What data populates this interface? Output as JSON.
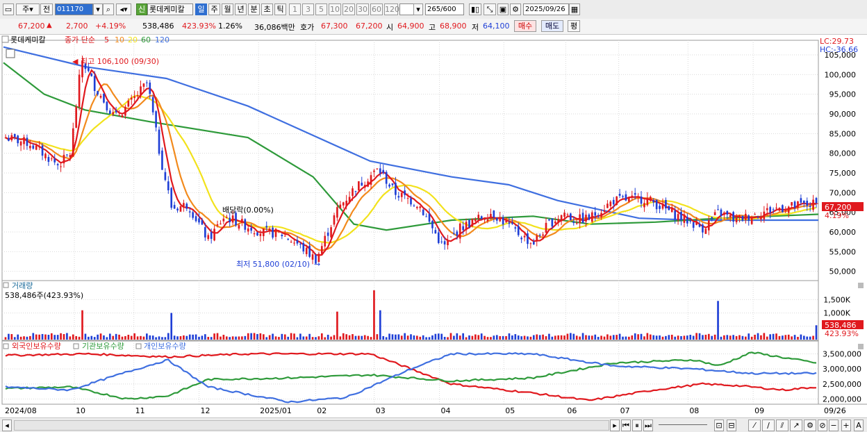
{
  "toolbar": {
    "period_primary": "주",
    "prev_label": "전",
    "stock_code": "011170",
    "badge": "신",
    "stock_name": "롯데케미칼",
    "periods": [
      "일",
      "주",
      "월",
      "년",
      "분",
      "초",
      "틱"
    ],
    "active_period": "일",
    "intervals": [
      "1",
      "3",
      "5",
      "10",
      "20",
      "30",
      "60",
      "120"
    ],
    "count": "265",
    "count_total": "/600",
    "date": "2025/09/26"
  },
  "quote": {
    "price": "67,200",
    "arrow": "▲",
    "change": "2,700",
    "change_pct": "+4.19%",
    "volume": "538,486",
    "volume_pct": "423.93%",
    "turnover_pct": "1.26%",
    "amount": "36,086백만",
    "hoga_label": "호가",
    "ask": "67,300",
    "bid": "67,200",
    "open_label": "시",
    "open": "64,900",
    "high_label": "고",
    "high": "68,900",
    "low_label": "저",
    "low": "64,100",
    "buy_btn": "매수",
    "sell_btn": "매도",
    "eval_btn": "평"
  },
  "legend": {
    "name": "롯데케미칼",
    "ma_label": "종가 단순",
    "periods": [
      "5",
      "10",
      "20",
      "60",
      "120"
    ]
  },
  "annotations": {
    "high": "최고 106,100 (09/30)",
    "low": "최저 51,800 (02/10)",
    "dividend": "배당락(0.00%)",
    "lc": "LC:29.73",
    "hc": "HC:-36.66",
    "last_price": "67,200",
    "last_pct": "4.19%"
  },
  "volume_panel": {
    "title": "거래량",
    "subtitle": "538,486주(423.93%)",
    "last_value": "538,486",
    "last_pct": "423.93%"
  },
  "holdings_panel": {
    "series_labels": [
      "외국인보유수량",
      "기관보유수량",
      "개인보유수량"
    ]
  },
  "colors": {
    "up": "#e0191e",
    "down": "#1f3fd6",
    "ma5": "#e0191e",
    "ma10": "#f28a1c",
    "ma20": "#f2e21c",
    "ma60": "#2e9a3a",
    "ma120": "#3f6fe0",
    "foreign": "#e0191e",
    "institution": "#2e9a3a",
    "individual": "#3f6fe0"
  },
  "chart_data": [
    {
      "type": "candlestick",
      "title": "롯데케미칼",
      "x_ticks": [
        "2024/08",
        "10",
        "11",
        "12",
        "2025/01",
        "02",
        "03",
        "04",
        "05",
        "06",
        "07",
        "08",
        "09",
        "09/26"
      ],
      "ylim": [
        48000,
        108000
      ],
      "y_ticks": [
        50000,
        55000,
        60000,
        65000,
        70000,
        75000,
        80000,
        85000,
        90000,
        95000,
        100000,
        105000
      ],
      "y_tick_labels": [
        "50,000",
        "55,000",
        "60,000",
        "65,000",
        "70,000",
        "75,000",
        "80,000",
        "85,000",
        "90,000",
        "95,000",
        "100,000",
        "105,000"
      ],
      "close_keypoints": [
        {
          "x": "2024/08",
          "y": 84000
        },
        {
          "x": "2024/08 mid",
          "y": 82500
        },
        {
          "x": "2024/09 early",
          "y": 77000
        },
        {
          "x": "2024/09 mid",
          "y": 80000
        },
        {
          "x": "2024/09/30",
          "y": 104000
        },
        {
          "x": "2024/10 early",
          "y": 97000
        },
        {
          "x": "2024/10 mid",
          "y": 89000
        },
        {
          "x": "2024/10 late",
          "y": 93000
        },
        {
          "x": "2024/11 early",
          "y": 98000
        },
        {
          "x": "2024/11 mid",
          "y": 80000
        },
        {
          "x": "2024/11 late",
          "y": 66000
        },
        {
          "x": "2024/12 early",
          "y": 67000
        },
        {
          "x": "2024/12 mid",
          "y": 58000
        },
        {
          "x": "2024/12 late",
          "y": 64000
        },
        {
          "x": "2025/01 early",
          "y": 60000
        },
        {
          "x": "2025/01 mid",
          "y": 59500
        },
        {
          "x": "2025/02 early",
          "y": 57000
        },
        {
          "x": "2025/02/10",
          "y": 53000
        },
        {
          "x": "2025/02 late",
          "y": 66000
        },
        {
          "x": "2025/03 early",
          "y": 71000
        },
        {
          "x": "2025/03 mid",
          "y": 76000
        },
        {
          "x": "2025/03 late",
          "y": 70000
        },
        {
          "x": "2025/04 early",
          "y": 67000
        },
        {
          "x": "2025/04 mid",
          "y": 56000
        },
        {
          "x": "2025/04 late",
          "y": 61000
        },
        {
          "x": "2025/05 early",
          "y": 65000
        },
        {
          "x": "2025/05 mid",
          "y": 60000
        },
        {
          "x": "2025/05 late",
          "y": 57000
        },
        {
          "x": "2025/06 early",
          "y": 62000
        },
        {
          "x": "2025/06 mid",
          "y": 65000
        },
        {
          "x": "2025/06 late",
          "y": 63000
        },
        {
          "x": "2025/07 early",
          "y": 63500
        },
        {
          "x": "2025/07 mid",
          "y": 68000
        },
        {
          "x": "2025/07 late",
          "y": 68500
        },
        {
          "x": "2025/08 early",
          "y": 64000
        },
        {
          "x": "2025/08 mid",
          "y": 61000
        },
        {
          "x": "2025/08 late",
          "y": 65000
        },
        {
          "x": "2025/09 early",
          "y": 63000
        },
        {
          "x": "2025/09 mid",
          "y": 66000
        },
        {
          "x": "2025/09/26",
          "y": 67200
        }
      ],
      "ma120_keypoints": [
        [
          0,
          107000
        ],
        [
          0.1,
          102000
        ],
        [
          0.2,
          99000
        ],
        [
          0.3,
          92000
        ],
        [
          0.45,
          78000
        ],
        [
          0.55,
          74000
        ],
        [
          0.62,
          72000
        ],
        [
          0.68,
          68000
        ],
        [
          0.78,
          63500
        ],
        [
          0.85,
          63000
        ],
        [
          0.92,
          63000
        ],
        [
          1,
          63000
        ]
      ],
      "ma60_keypoints": [
        [
          0,
          103000
        ],
        [
          0.05,
          95000
        ],
        [
          0.1,
          91000
        ],
        [
          0.18,
          88000
        ],
        [
          0.3,
          84000
        ],
        [
          0.38,
          74000
        ],
        [
          0.43,
          62000
        ],
        [
          0.47,
          60500
        ],
        [
          0.55,
          63000
        ],
        [
          0.65,
          64000
        ],
        [
          0.72,
          62000
        ],
        [
          0.8,
          62500
        ],
        [
          0.88,
          63500
        ],
        [
          1,
          64500
        ]
      ],
      "series": [
        {
          "name": "5"
        },
        {
          "name": "10"
        },
        {
          "name": "20"
        },
        {
          "name": "60"
        },
        {
          "name": "120"
        }
      ]
    },
    {
      "type": "bar",
      "title": "거래량",
      "y_tick_labels": [
        "500K",
        "1,000K",
        "1,500K"
      ],
      "ylim": [
        0,
        1900000
      ],
      "last_value": 538486,
      "spikes": [
        {
          "x": "2024/09/30",
          "y": 1100000
        },
        {
          "x": "2024/11 mid",
          "y": 1000000
        },
        {
          "x": "2025/02 late",
          "y": 1050000
        },
        {
          "x": "2025/03 early",
          "y": 1850000
        },
        {
          "x": "2025/03 early+",
          "y": 1100000
        },
        {
          "x": "2025/08 mid",
          "y": 1450000
        },
        {
          "x": "2025/09/26",
          "y": 538486
        }
      ]
    },
    {
      "type": "line",
      "title": "",
      "y_tick_labels": [
        "2,000,000",
        "2,500,000",
        "3,000,000",
        "3,500,000"
      ],
      "ylim": [
        1850000,
        3650000
      ],
      "series": [
        {
          "name": "외국인보유수량",
          "keypoints": [
            [
              0,
              3450000
            ],
            [
              0.1,
              3500000
            ],
            [
              0.2,
              3400000
            ],
            [
              0.3,
              3500000
            ],
            [
              0.45,
              3500000
            ],
            [
              0.5,
              3000000
            ],
            [
              0.55,
              2500000
            ],
            [
              0.65,
              2200000
            ],
            [
              0.72,
              1950000
            ],
            [
              0.8,
              2300000
            ],
            [
              0.86,
              2500000
            ],
            [
              0.9,
              2450000
            ],
            [
              0.96,
              2300000
            ],
            [
              1,
              2400000
            ]
          ]
        },
        {
          "name": "기관보유수량",
          "keypoints": [
            [
              0,
              2350000
            ],
            [
              0.08,
              2400000
            ],
            [
              0.15,
              2000000
            ],
            [
              0.2,
              2100000
            ],
            [
              0.25,
              2650000
            ],
            [
              0.35,
              2700000
            ],
            [
              0.45,
              2800000
            ],
            [
              0.5,
              2700000
            ],
            [
              0.55,
              2600000
            ],
            [
              0.65,
              2700000
            ],
            [
              0.75,
              3200000
            ],
            [
              0.85,
              3300000
            ],
            [
              0.88,
              3100000
            ],
            [
              0.92,
              3550000
            ],
            [
              1,
              3200000
            ]
          ]
        },
        {
          "name": "개인보유수량",
          "keypoints": [
            [
              0,
              2400000
            ],
            [
              0.08,
              2300000
            ],
            [
              0.15,
              2900000
            ],
            [
              0.2,
              3300000
            ],
            [
              0.25,
              2400000
            ],
            [
              0.35,
              1900000
            ],
            [
              0.42,
              2050000
            ],
            [
              0.5,
              3000000
            ],
            [
              0.55,
              3500000
            ],
            [
              0.65,
              3500000
            ],
            [
              0.75,
              3100000
            ],
            [
              0.85,
              3000000
            ],
            [
              0.92,
              2850000
            ],
            [
              1,
              2850000
            ]
          ]
        }
      ]
    }
  ]
}
